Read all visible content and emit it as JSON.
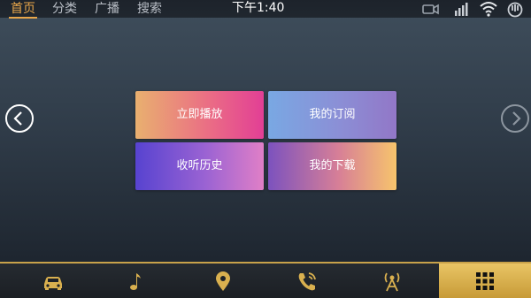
{
  "topbar": {
    "tabs": [
      {
        "label": "首页",
        "active": true
      },
      {
        "label": "分类",
        "active": false
      },
      {
        "label": "广播",
        "active": false
      },
      {
        "label": "搜索",
        "active": false
      }
    ],
    "clock": "下午1:40",
    "status_icons": [
      "video-camera-icon",
      "signal-bars-icon",
      "wifi-icon",
      "usb-icon"
    ]
  },
  "nav": {
    "prev_icon": "chevron-left-icon",
    "next_icon": "chevron-right-icon"
  },
  "tiles": [
    {
      "label": "立即播放"
    },
    {
      "label": "我的订阅"
    },
    {
      "label": "收听历史"
    },
    {
      "label": "我的下载"
    }
  ],
  "dock": {
    "items": [
      "car-icon",
      "music-note-icon",
      "location-pin-icon",
      "phone-icon",
      "radio-tower-icon",
      "apps-grid-icon"
    ],
    "active_index": 5,
    "accent": "#d9b04f"
  },
  "colors": {
    "active_tab": "#e8a64a",
    "dock_accent": "#c8a24a"
  }
}
